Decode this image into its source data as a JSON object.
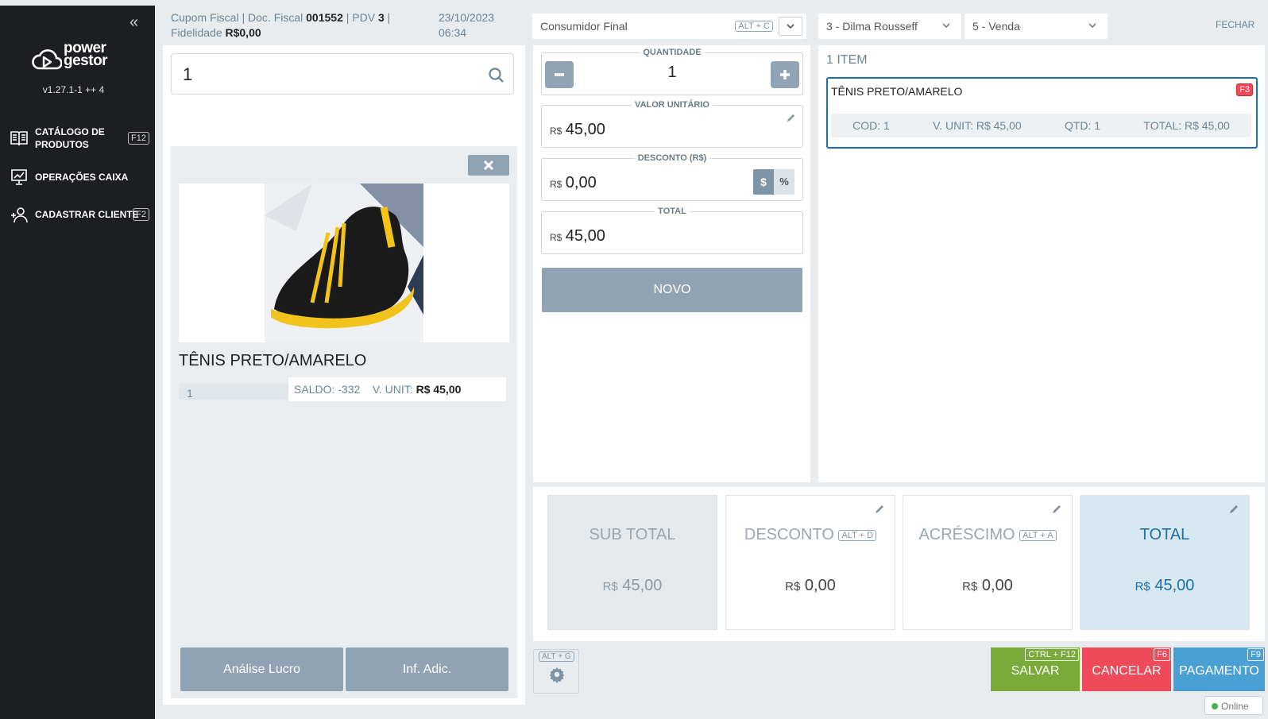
{
  "app": {
    "brand_line1": "power",
    "brand_line2": "gestor",
    "version": "v1.27.1-1 ++ 4",
    "collapse_icon": "double-chevron-left-icon"
  },
  "sidebar": {
    "items": [
      {
        "label_line1": "CATÁLOGO DE",
        "label_line2": "PRODUTOS",
        "shortcut": "F12",
        "icon": "book-icon"
      },
      {
        "label_line1": "OPERAÇÕES CAIXA",
        "label_line2": "",
        "shortcut": "",
        "icon": "chart-board-icon"
      },
      {
        "label_line1": "CADASTRAR CLIENTE",
        "label_line2": "",
        "shortcut": "F2",
        "icon": "add-user-icon"
      }
    ]
  },
  "header": {
    "doc_type": "Cupom Fiscal",
    "doc_label": "Doc. Fiscal",
    "doc_number": "001552",
    "pdv_label": "PDV",
    "pdv_number": "3",
    "loyalty_label": "Fidelidade",
    "loyalty_value": "R$0,00",
    "date": "23/10/2023",
    "time": "06:34",
    "customer": "Consumidor Final",
    "customer_shortcut": "ALT + C",
    "seller": "3 - Dilma Rousseff",
    "operation": "5 - Venda",
    "close_label": "FECHAR"
  },
  "product_panel": {
    "search_value": "1",
    "product_name": "TÊNIS PRETO/AMARELO",
    "code": "1",
    "balance_label": "SALDO:",
    "balance_value": "-332",
    "unit_label": "V. UNIT:",
    "unit_value": "R$ 45,00",
    "btn_profit": "Análise Lucro",
    "btn_info": "Inf. Adic."
  },
  "entry": {
    "qty_label": "QUANTIDADE",
    "qty_value": "1",
    "unit_price_label": "VALOR UNITÁRIO",
    "currency": "R$",
    "unit_price_value": "45,00",
    "discount_label": "DESCONTO (R$)",
    "discount_value": "0,00",
    "discount_mode_money": "$",
    "discount_mode_percent": "%",
    "total_label": "TOTAL",
    "total_value": "45,00",
    "new_button": "NOVO"
  },
  "cart": {
    "count_label": "1 ITEM",
    "items": [
      {
        "name": "TÊNIS PRETO/AMARELO",
        "shortcut": "F3",
        "cod": "COD: 1",
        "unit": "V. UNIT: R$ 45,00",
        "qty": "QTD: 1",
        "total": "TOTAL: R$ 45,00"
      }
    ]
  },
  "summary": {
    "currency": "R$",
    "subtotal_label": "SUB TOTAL",
    "subtotal_value": "45,00",
    "discount_label": "DESCONTO",
    "discount_shortcut": "ALT + D",
    "discount_value": "0,00",
    "surcharge_label": "ACRÉSCIMO",
    "surcharge_shortcut": "ALT + A",
    "surcharge_value": "0,00",
    "total_label": "TOTAL",
    "total_value": "45,00"
  },
  "actions": {
    "settings_shortcut": "ALT + G",
    "save_label": "SALVAR",
    "save_shortcut": "CTRL + F12",
    "cancel_label": "CANCELAR",
    "cancel_shortcut": "F6",
    "payment_label": "PAGAMENTO",
    "payment_shortcut": "F9",
    "status": "Online"
  },
  "colors": {
    "sidebar_bg": "#1c1e21",
    "save": "#7aab3a",
    "cancel": "#ee4a5a",
    "payment": "#4a9fd4",
    "total_card": "#d8e8f2",
    "accent_blue": "#1d6fa8",
    "online": "#4caf50"
  }
}
